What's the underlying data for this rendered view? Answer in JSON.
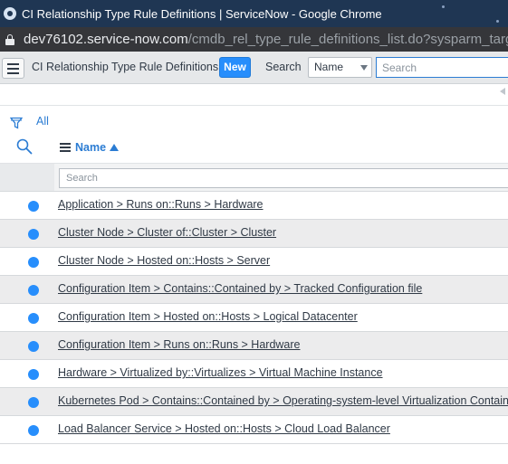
{
  "browser": {
    "window_title": "CI Relationship Type Rule Definitions | ServiceNow - Google Chrome",
    "url_host": "dev76102.service-now.com",
    "url_path": "/cmdb_rel_type_rule_definitions_list.do?sysparm_target=svc"
  },
  "list_header": {
    "title": "CI Relationship Type Rule Definitions",
    "new_label": "New",
    "search_label": "Search",
    "search_field": "Name",
    "search_placeholder": "Search"
  },
  "filter": {
    "breadcrumb": "All"
  },
  "columns": {
    "name": "Name"
  },
  "column_search": {
    "placeholder": "Search"
  },
  "records": [
    "Application > Runs on::Runs > Hardware",
    "Cluster Node > Cluster of::Cluster > Cluster",
    "Cluster Node > Hosted on::Hosts > Server",
    "Configuration Item > Contains::Contained by > Tracked Configuration file",
    "Configuration Item > Hosted on::Hosts > Logical Datacenter",
    "Configuration Item > Runs on::Runs > Hardware",
    "Hardware > Virtualized by::Virtualizes > Virtual Machine Instance",
    "Kubernetes Pod > Contains::Contained by > Operating-system-level Virtualization Container",
    "Load Balancer Service > Hosted on::Hosts > Cloud Load Balancer"
  ],
  "colors": {
    "accent": "#278efc",
    "title_bar": "#1f3653",
    "url_bar": "#35363a",
    "header_bg": "#e6e8ea"
  },
  "icons": {
    "menu": "hamburger-menu-icon",
    "filter": "funnel-icon",
    "column_search": "magnifier-icon",
    "column_options": "column-menu-icon",
    "sort": "sort-ascending-icon",
    "row": "record-dot-icon"
  }
}
